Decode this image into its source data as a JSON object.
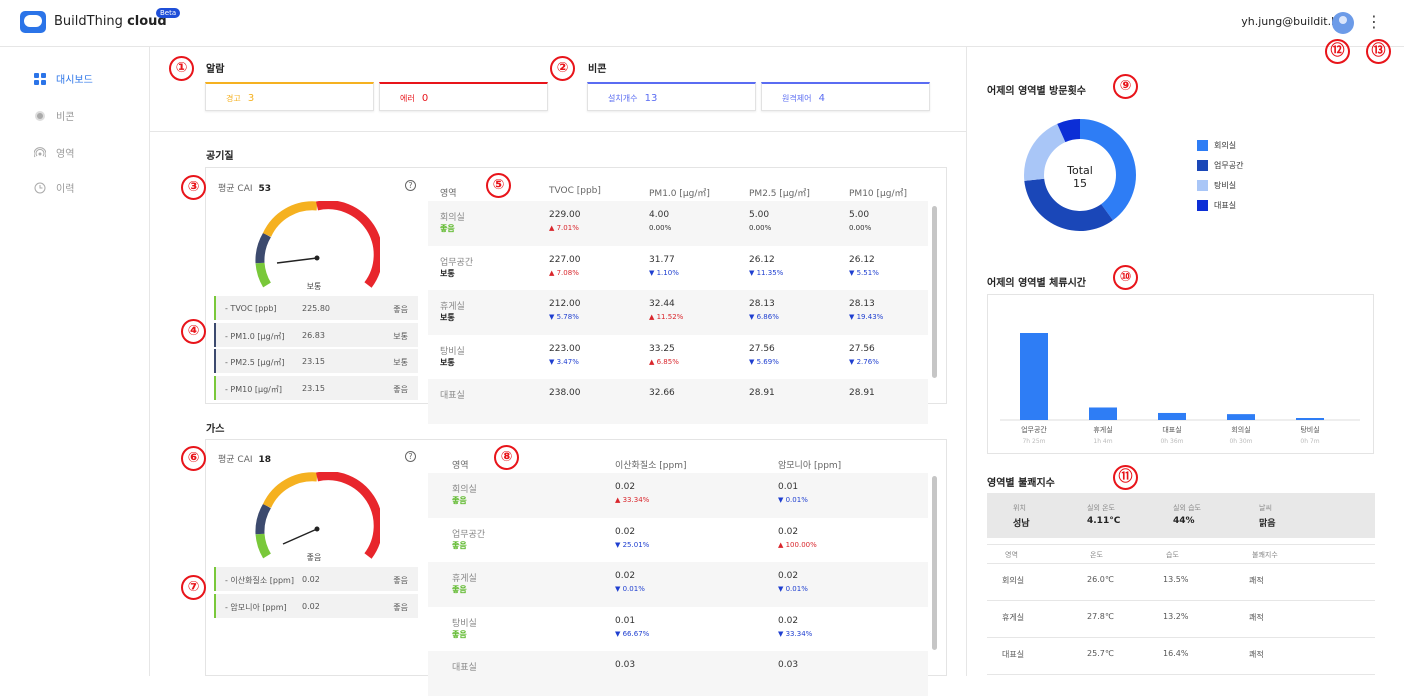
{
  "app": {
    "brand_light": "BuildThing ",
    "brand_bold": "cloud",
    "beta": "Beta"
  },
  "user": {
    "email": "yh.jung@buildit.kr",
    "menu_icon": "⋮"
  },
  "sidebar": {
    "items": [
      {
        "label": "대시보드",
        "icon": "dashboard-icon",
        "active": true
      },
      {
        "label": "비콘",
        "icon": "beacon-icon"
      },
      {
        "label": "영역",
        "icon": "area-icon"
      },
      {
        "label": "이력",
        "icon": "history-icon"
      }
    ]
  },
  "markers": [
    "①",
    "②",
    "③",
    "④",
    "⑤",
    "⑥",
    "⑦",
    "⑧",
    "⑨",
    "⑩",
    "⑪",
    "⑫",
    "⑬"
  ],
  "alarm": {
    "title": "알람",
    "warn_label": "경고",
    "warn_value": "3",
    "error_label": "에러",
    "error_value": "0"
  },
  "beacon": {
    "title": "비콘",
    "installed_label": "설치개수",
    "installed_value": "13",
    "remote_label": "원격제어",
    "remote_value": "4"
  },
  "air": {
    "title": "공기질",
    "cai_label": "평균 CAI",
    "cai_value": "53",
    "gauge_status": "보통",
    "metrics": [
      {
        "name": "TVOC [ppb]",
        "value": "225.80",
        "status": "좋음",
        "color": "#79c83a"
      },
      {
        "name": "PM1.0 [μg/㎥]",
        "value": "26.83",
        "status": "보통",
        "color": "#3c4a6e"
      },
      {
        "name": "PM2.5 [μg/㎥]",
        "value": "23.15",
        "status": "보통",
        "color": "#3c4a6e"
      },
      {
        "name": "PM10 [μg/㎥]",
        "value": "23.15",
        "status": "좋음",
        "color": "#79c83a"
      }
    ],
    "table": {
      "headers": [
        "영역",
        "TVOC [ppb]",
        "PM1.0 [μg/㎥]",
        "PM2.5 [μg/㎥]",
        "PM10 [μg/㎥]"
      ],
      "rows": [
        {
          "name": "회의실",
          "status": "좋음",
          "cells": [
            [
              "229.00",
              "▲ 7.01%"
            ],
            [
              "4.00",
              "0.00%"
            ],
            [
              "5.00",
              "0.00%"
            ],
            [
              "5.00",
              "0.00%"
            ]
          ]
        },
        {
          "name": "업무공간",
          "status": "보통",
          "cells": [
            [
              "227.00",
              "▲ 7.08%"
            ],
            [
              "31.77",
              "▼ 1.10%"
            ],
            [
              "26.12",
              "▼ 11.35%"
            ],
            [
              "26.12",
              "▼ 5.51%"
            ]
          ]
        },
        {
          "name": "휴게실",
          "status": "보통",
          "cells": [
            [
              "212.00",
              "▼ 5.78%"
            ],
            [
              "32.44",
              "▲ 11.52%"
            ],
            [
              "28.13",
              "▼ 6.86%"
            ],
            [
              "28.13",
              "▼ 19.43%"
            ]
          ]
        },
        {
          "name": "탕비실",
          "status": "보통",
          "cells": [
            [
              "223.00",
              "▼ 3.47%"
            ],
            [
              "33.25",
              "▲ 6.85%"
            ],
            [
              "27.56",
              "▼ 5.69%"
            ],
            [
              "27.56",
              "▼ 2.76%"
            ]
          ]
        },
        {
          "name": "대표실",
          "status": "",
          "cells": [
            [
              "238.00",
              ""
            ],
            [
              "32.66",
              ""
            ],
            [
              "28.91",
              ""
            ],
            [
              "28.91",
              ""
            ]
          ]
        }
      ]
    }
  },
  "gas": {
    "title": "가스",
    "cai_label": "평균 CAI",
    "cai_value": "18",
    "gauge_status": "좋음",
    "metrics": [
      {
        "name": "이산화질소 [ppm]",
        "value": "0.02",
        "status": "좋음",
        "color": "#79c83a"
      },
      {
        "name": "암모니아 [ppm]",
        "value": "0.02",
        "status": "좋음",
        "color": "#79c83a"
      }
    ],
    "table": {
      "headers": [
        "영역",
        "이산화질소 [ppm]",
        "암모니아 [ppm]"
      ],
      "rows": [
        {
          "name": "회의실",
          "status": "좋음",
          "cells": [
            [
              "0.02",
              "▲ 33.34%"
            ],
            [
              "0.01",
              "▼ 0.01%"
            ]
          ]
        },
        {
          "name": "업무공간",
          "status": "좋음",
          "cells": [
            [
              "0.02",
              "▼ 25.01%"
            ],
            [
              "0.02",
              "▲ 100.00%"
            ]
          ]
        },
        {
          "name": "휴게실",
          "status": "좋음",
          "cells": [
            [
              "0.02",
              "▼ 0.01%"
            ],
            [
              "0.02",
              "▼ 0.01%"
            ]
          ]
        },
        {
          "name": "탕비실",
          "status": "좋음",
          "cells": [
            [
              "0.01",
              "▼ 66.67%"
            ],
            [
              "0.02",
              "▼ 33.34%"
            ]
          ]
        },
        {
          "name": "대표실",
          "status": "",
          "cells": [
            [
              "0.03",
              ""
            ],
            [
              "0.03",
              ""
            ]
          ]
        }
      ]
    }
  },
  "visits": {
    "title": "어제의 영역별 방문횟수",
    "total_label": "Total",
    "total_value": "15"
  },
  "dwell": {
    "title": "어제의 영역별 체류시간"
  },
  "discomfort": {
    "title": "영역별 불쾌지수",
    "summary_headers": [
      "위치",
      "실외 온도",
      "실외 습도",
      "날씨"
    ],
    "summary_values": [
      "성남",
      "4.11°C",
      "44%",
      "맑음"
    ],
    "headers": [
      "영역",
      "온도",
      "습도",
      "불쾌지수"
    ],
    "rows": [
      [
        "회의실",
        "26.0℃",
        "13.5%",
        "쾌적"
      ],
      [
        "휴게실",
        "27.8℃",
        "13.2%",
        "쾌적"
      ],
      [
        "대표실",
        "25.7℃",
        "16.4%",
        "쾌적"
      ]
    ]
  },
  "chart_data": [
    {
      "type": "pie",
      "title": "어제의 영역별 방문횟수",
      "categories": [
        "회의실",
        "업무공간",
        "탕비실",
        "대표실"
      ],
      "values": [
        6,
        5,
        3,
        1
      ],
      "colors": [
        "#2e7df5",
        "#1a47b8",
        "#a9c6f7",
        "#0c2ed6"
      ]
    },
    {
      "type": "bar",
      "title": "어제의 영역별 체류시간",
      "categories": [
        "업무공간",
        "휴게실",
        "대표실",
        "회의실",
        "탕비실"
      ],
      "sublabels": [
        "7h 25m",
        "1h 4m",
        "0h 36m",
        "0h 30m",
        "0h 7m"
      ],
      "values": [
        445,
        64,
        36,
        30,
        7
      ],
      "color": "#2e7df5"
    }
  ]
}
